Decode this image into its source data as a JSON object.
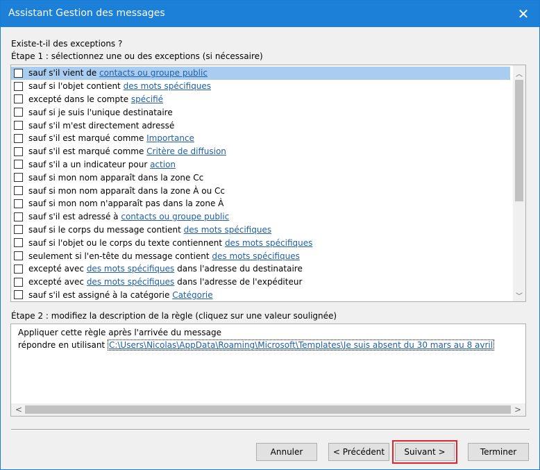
{
  "window": {
    "title": "Assistant Gestion des messages",
    "close_glyph": "✕"
  },
  "headings": {
    "question": "Existe-t-il des exceptions ?",
    "step1": "Étape 1 : sélectionnez une ou des exceptions (si nécessaire)",
    "step2": "Étape 2 : modifiez la description de la règle (cliquez sur une valeur soulignée)"
  },
  "exceptions": [
    {
      "text": "sauf s'il vient de ",
      "link": "contacts ou groupe public",
      "after": "",
      "checked": false,
      "selected": true
    },
    {
      "text": "sauf si l'objet contient ",
      "link": "des mots spécifiques",
      "after": "",
      "checked": false,
      "selected": false
    },
    {
      "text": "excepté dans le compte ",
      "link": "spécifié",
      "after": "",
      "checked": false,
      "selected": false
    },
    {
      "text": "sauf si je suis l'unique destinataire",
      "link": "",
      "after": "",
      "checked": false,
      "selected": false
    },
    {
      "text": "sauf s'il m'est directement adressé",
      "link": "",
      "after": "",
      "checked": false,
      "selected": false
    },
    {
      "text": "sauf s'il est marqué comme ",
      "link": "Importance",
      "after": "",
      "checked": false,
      "selected": false
    },
    {
      "text": "sauf s'il est marqué comme ",
      "link": "Critère de diffusion",
      "after": "",
      "checked": false,
      "selected": false
    },
    {
      "text": "sauf s'il a un indicateur pour ",
      "link": "action",
      "after": "",
      "checked": false,
      "selected": false
    },
    {
      "text": "sauf si mon nom apparaît dans la zone Cc",
      "link": "",
      "after": "",
      "checked": false,
      "selected": false
    },
    {
      "text": "sauf si mon nom apparaît dans la zone À ou Cc",
      "link": "",
      "after": "",
      "checked": false,
      "selected": false
    },
    {
      "text": "sauf si mon nom n'apparaît pas dans la zone À",
      "link": "",
      "after": "",
      "checked": false,
      "selected": false
    },
    {
      "text": "sauf s'il est adressé à ",
      "link": "contacts ou groupe public",
      "after": "",
      "checked": false,
      "selected": false
    },
    {
      "text": "sauf si le corps du message contient ",
      "link": "des mots spécifiques",
      "after": "",
      "checked": false,
      "selected": false
    },
    {
      "text": "sauf si l'objet ou le corps du texte contiennent ",
      "link": "des mots spécifiques",
      "after": "",
      "checked": false,
      "selected": false
    },
    {
      "text": "seulement si l'en-tête du message contient ",
      "link": "des mots spécifiques",
      "after": "",
      "checked": false,
      "selected": false
    },
    {
      "text": "excepté avec ",
      "link": "des mots spécifiques",
      "after": " dans l'adresse du destinataire",
      "checked": false,
      "selected": false
    },
    {
      "text": "excepté avec ",
      "link": "des mots spécifiques",
      "after": " dans l'adresse de l'expéditeur",
      "checked": false,
      "selected": false
    },
    {
      "text": "sauf s'il est assigné à la catégorie ",
      "link": "Catégorie",
      "after": "",
      "checked": false,
      "selected": false
    }
  ],
  "list_scroll": {
    "up": "︿",
    "down": "﹀"
  },
  "description": {
    "line1": "Appliquer cette règle après l'arrivée du message",
    "line2_prefix": "répondre en utilisant ",
    "line2_link": "C:\\Users\\Nicolas\\AppData\\Roaming\\Microsoft\\Templates\\Je suis absent du 30 mars au 8 avril",
    "scroll_left": "<",
    "scroll_right": ">"
  },
  "buttons": {
    "cancel": "Annuler",
    "previous": "< Précédent",
    "next": "Suivant >",
    "finish": "Terminer"
  },
  "colors": {
    "titlebar": "#1c7fd8",
    "link": "#1f5ea8",
    "selection": "#a9cdf0",
    "highlight": "#e0242b"
  }
}
